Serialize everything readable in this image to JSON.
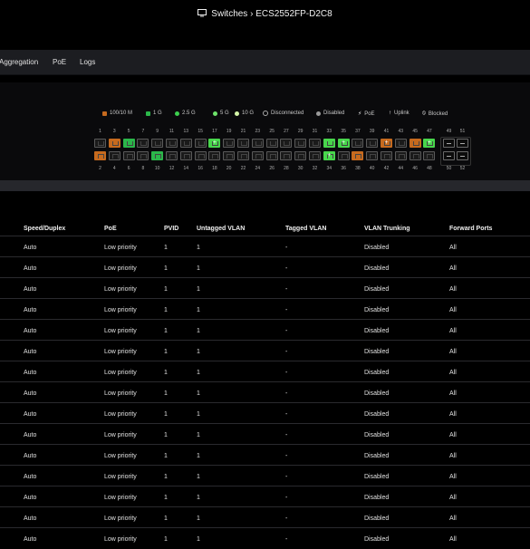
{
  "title": {
    "text": "Switches › ECS2552FP-D2C8",
    "icon": "monitor-icon"
  },
  "tabs": [
    {
      "label": "Aggregation"
    },
    {
      "label": "PoE"
    },
    {
      "label": "Logs"
    }
  ],
  "legend": [
    {
      "label": "100/10 M",
      "color": "#c66a1e"
    },
    {
      "label": "1 G",
      "color": "#2bb74a"
    },
    {
      "label": "2.5 G",
      "color": "#3ccf4e"
    },
    {
      "label": "5 G",
      "color": "#6ee36a"
    },
    {
      "label": "10 G",
      "color": "#d5f5a8"
    },
    {
      "label": "Disconnected",
      "color": "#000000"
    },
    {
      "label": "Disabled",
      "color": "#9a9a9a"
    },
    {
      "label": "PoE",
      "color": "#ffffff"
    },
    {
      "label": "Uplink",
      "color": "#ffffff"
    },
    {
      "label": "Blocked",
      "color": "#ffffff"
    }
  ],
  "ports": {
    "top_numbers": [
      "1",
      "3",
      "5",
      "7",
      "9",
      "11",
      "13",
      "15",
      "17",
      "19",
      "21",
      "23",
      "25",
      "27",
      "29",
      "31",
      "33",
      "35",
      "37",
      "39",
      "41",
      "43",
      "45",
      "47"
    ],
    "bottom_numbers": [
      "2",
      "4",
      "6",
      "8",
      "10",
      "12",
      "14",
      "16",
      "18",
      "20",
      "22",
      "24",
      "26",
      "28",
      "30",
      "32",
      "34",
      "36",
      "38",
      "40",
      "42",
      "44",
      "46",
      "48"
    ],
    "sfp_top": [
      "49",
      "51"
    ],
    "sfp_bottom": [
      "50",
      "52"
    ],
    "top_states": [
      "off",
      "100",
      "1g",
      "off",
      "off",
      "off",
      "off",
      "off",
      "5g-plus",
      "off",
      "off",
      "off",
      "off",
      "off",
      "off",
      "off",
      "5g",
      "5g-plus",
      "off",
      "off",
      "100-plus",
      "off",
      "100",
      "5g-plus"
    ],
    "bottom_states": [
      "100",
      "off",
      "off",
      "off",
      "1g",
      "off",
      "off",
      "off",
      "off",
      "off",
      "off",
      "off",
      "off",
      "off",
      "off",
      "off",
      "5g-plus",
      "off",
      "100",
      "off",
      "off",
      "off",
      "off",
      "off"
    ]
  },
  "table": {
    "headers": [
      "Speed/Duplex",
      "PoE",
      "PVID",
      "Untagged VLAN",
      "Tagged VLAN",
      "VLAN Trunking",
      "Forward Ports"
    ],
    "rows": [
      [
        "Auto",
        "Low priority",
        "1",
        "1",
        "-",
        "Disabled",
        "All"
      ],
      [
        "Auto",
        "Low priority",
        "1",
        "1",
        "-",
        "Disabled",
        "All"
      ],
      [
        "Auto",
        "Low priority",
        "1",
        "1",
        "-",
        "Disabled",
        "All"
      ],
      [
        "Auto",
        "Low priority",
        "1",
        "1",
        "-",
        "Disabled",
        "All"
      ],
      [
        "Auto",
        "Low priority",
        "1",
        "1",
        "-",
        "Disabled",
        "All"
      ],
      [
        "Auto",
        "Low priority",
        "1",
        "1",
        "-",
        "Disabled",
        "All"
      ],
      [
        "Auto",
        "Low priority",
        "1",
        "1",
        "-",
        "Disabled",
        "All"
      ],
      [
        "Auto",
        "Low priority",
        "1",
        "1",
        "-",
        "Disabled",
        "All"
      ],
      [
        "Auto",
        "Low priority",
        "1",
        "1",
        "-",
        "Disabled",
        "All"
      ],
      [
        "Auto",
        "Low priority",
        "1",
        "1",
        "-",
        "Disabled",
        "All"
      ],
      [
        "Auto",
        "Low priority",
        "1",
        "1",
        "-",
        "Disabled",
        "All"
      ],
      [
        "Auto",
        "Low priority",
        "1",
        "1",
        "-",
        "Disabled",
        "All"
      ],
      [
        "Auto",
        "Low priority",
        "1",
        "1",
        "-",
        "Disabled",
        "All"
      ],
      [
        "Auto",
        "Low priority",
        "1",
        "1",
        "-",
        "Disabled",
        "All"
      ],
      [
        "Auto",
        "Low priority",
        "1",
        "1",
        "-",
        "Disabled",
        "All"
      ]
    ]
  }
}
